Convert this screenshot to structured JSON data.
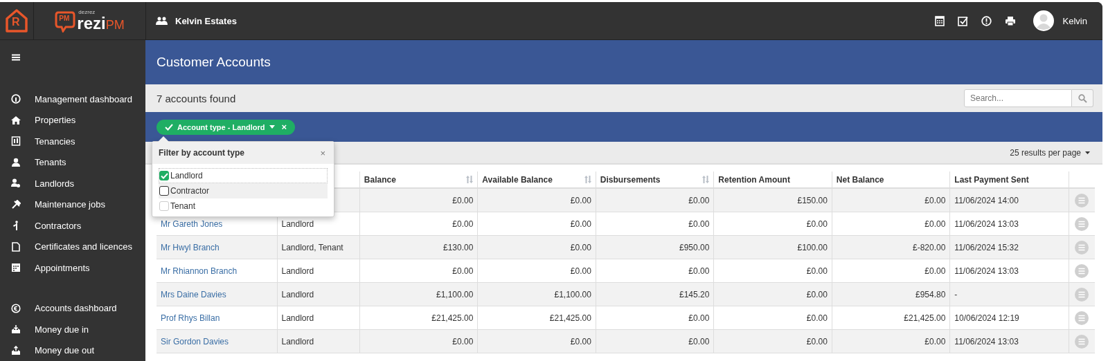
{
  "logo": {
    "house_letter": "R",
    "badge": "PM",
    "small": "dezrez",
    "main": "rezi",
    "accent": "PM"
  },
  "topbar": {
    "agency": "Kelvin Estates",
    "user": "Kelvin"
  },
  "sidebar": {
    "groups": [
      [
        {
          "label": "Management dashboard"
        },
        {
          "label": "Properties"
        },
        {
          "label": "Tenancies"
        },
        {
          "label": "Tenants"
        },
        {
          "label": "Landlords"
        },
        {
          "label": "Maintenance jobs"
        },
        {
          "label": "Contractors"
        },
        {
          "label": "Certificates and licences"
        },
        {
          "label": "Appointments"
        }
      ],
      [
        {
          "label": "Accounts dashboard"
        },
        {
          "label": "Money due in"
        },
        {
          "label": "Money due out"
        }
      ]
    ]
  },
  "page_title": "Customer Accounts",
  "count": "7 accounts found",
  "search": {
    "placeholder": "Search..."
  },
  "filter_chip": {
    "label": "Account type - Landlord",
    "remove": "×"
  },
  "filter_popover": {
    "title": "Filter by account type",
    "close": "×",
    "options": [
      {
        "label": "Landlord",
        "checked": true
      },
      {
        "label": "Contractor",
        "checked": false
      },
      {
        "label": "Tenant",
        "checked": false
      }
    ]
  },
  "per_page": "25 results per page",
  "table": {
    "columns": [
      {
        "label": "Balance",
        "sortable": true
      },
      {
        "label": "Available Balance",
        "sortable": true
      },
      {
        "label": "Disbursements",
        "sortable": true
      },
      {
        "label": "Retention Amount",
        "sortable": false
      },
      {
        "label": "Net Balance",
        "sortable": false
      },
      {
        "label": "Last Payment Sent",
        "sortable": false
      }
    ],
    "rows": [
      {
        "cells": [
          "£0.00",
          "£0.00",
          "£0.00",
          "£150.00",
          "£0.00",
          "11/06/2024 14:00"
        ]
      },
      {
        "name": "Mr Gareth Jones",
        "type": "Landlord",
        "cells": [
          "£0.00",
          "£0.00",
          "£0.00",
          "£0.00",
          "£0.00",
          "11/06/2024 13:03"
        ]
      },
      {
        "name": "Mr Hwyl Branch",
        "type": "Landlord, Tenant",
        "cells": [
          "£130.00",
          "£0.00",
          "£950.00",
          "£100.00",
          "£-820.00",
          "11/06/2024 15:32"
        ]
      },
      {
        "name": "Mr Rhiannon Branch",
        "type": "Landlord",
        "cells": [
          "£0.00",
          "£0.00",
          "£0.00",
          "£0.00",
          "£0.00",
          "11/06/2024 13:03"
        ]
      },
      {
        "name": "Mrs Daine Davies",
        "type": "Landlord",
        "cells": [
          "£1,100.00",
          "£1,100.00",
          "£145.20",
          "£0.00",
          "£954.80",
          "-"
        ]
      },
      {
        "name": "Prof Rhys Billan",
        "type": "Landlord",
        "cells": [
          "£21,425.00",
          "£21,425.00",
          "£0.00",
          "£0.00",
          "£21,425.00",
          "10/06/2024 12:19"
        ]
      },
      {
        "name": "Sir Gordon Davies",
        "type": "Landlord",
        "cells": [
          "£0.00",
          "£0.00",
          "£0.00",
          "£0.00",
          "£0.00",
          "11/06/2024 13:03"
        ]
      }
    ]
  }
}
